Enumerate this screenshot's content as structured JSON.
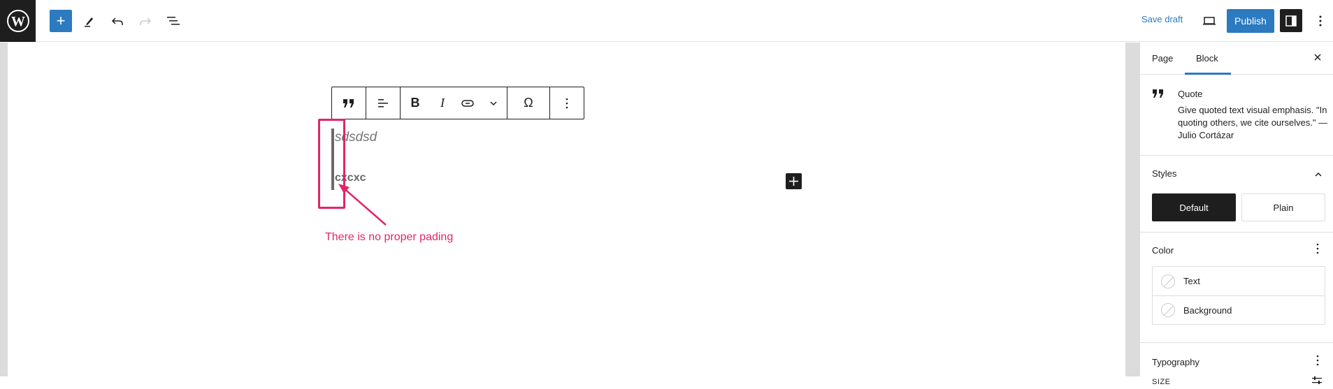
{
  "header": {
    "logo": "wordpress-logo",
    "add_block": "+",
    "save_draft": "Save draft",
    "publish": "Publish"
  },
  "block_toolbar": {
    "buttons": [
      "quote-icon",
      "align-icon",
      "B",
      "I",
      "link-icon",
      "more-icon",
      "Ω",
      "options-icon"
    ],
    "bold": "B",
    "italic": "I",
    "special_char": "Ω"
  },
  "editor": {
    "quote_text": "sdsdsd",
    "quote_citation": "cxcxc",
    "annotation": "There is no proper pading",
    "annotation_color": "#e3246a"
  },
  "sidebar": {
    "tabs": [
      {
        "label": "Page"
      },
      {
        "label": "Block"
      }
    ],
    "active_tab": "Block",
    "block_card": {
      "title": "Quote",
      "description": "Give quoted text visual emphasis. \"In quoting others, we cite ourselves.\" — Julio Cortázar"
    },
    "styles": {
      "title": "Styles",
      "options": [
        "Default",
        "Plain"
      ],
      "selected": "Default"
    },
    "color": {
      "title": "Color",
      "items": [
        "Text",
        "Background"
      ]
    },
    "typography": {
      "title": "Typography",
      "size_label": "SIZE"
    }
  },
  "colors": {
    "accent": "#2c7ac0",
    "dark": "#1e1e1e"
  }
}
